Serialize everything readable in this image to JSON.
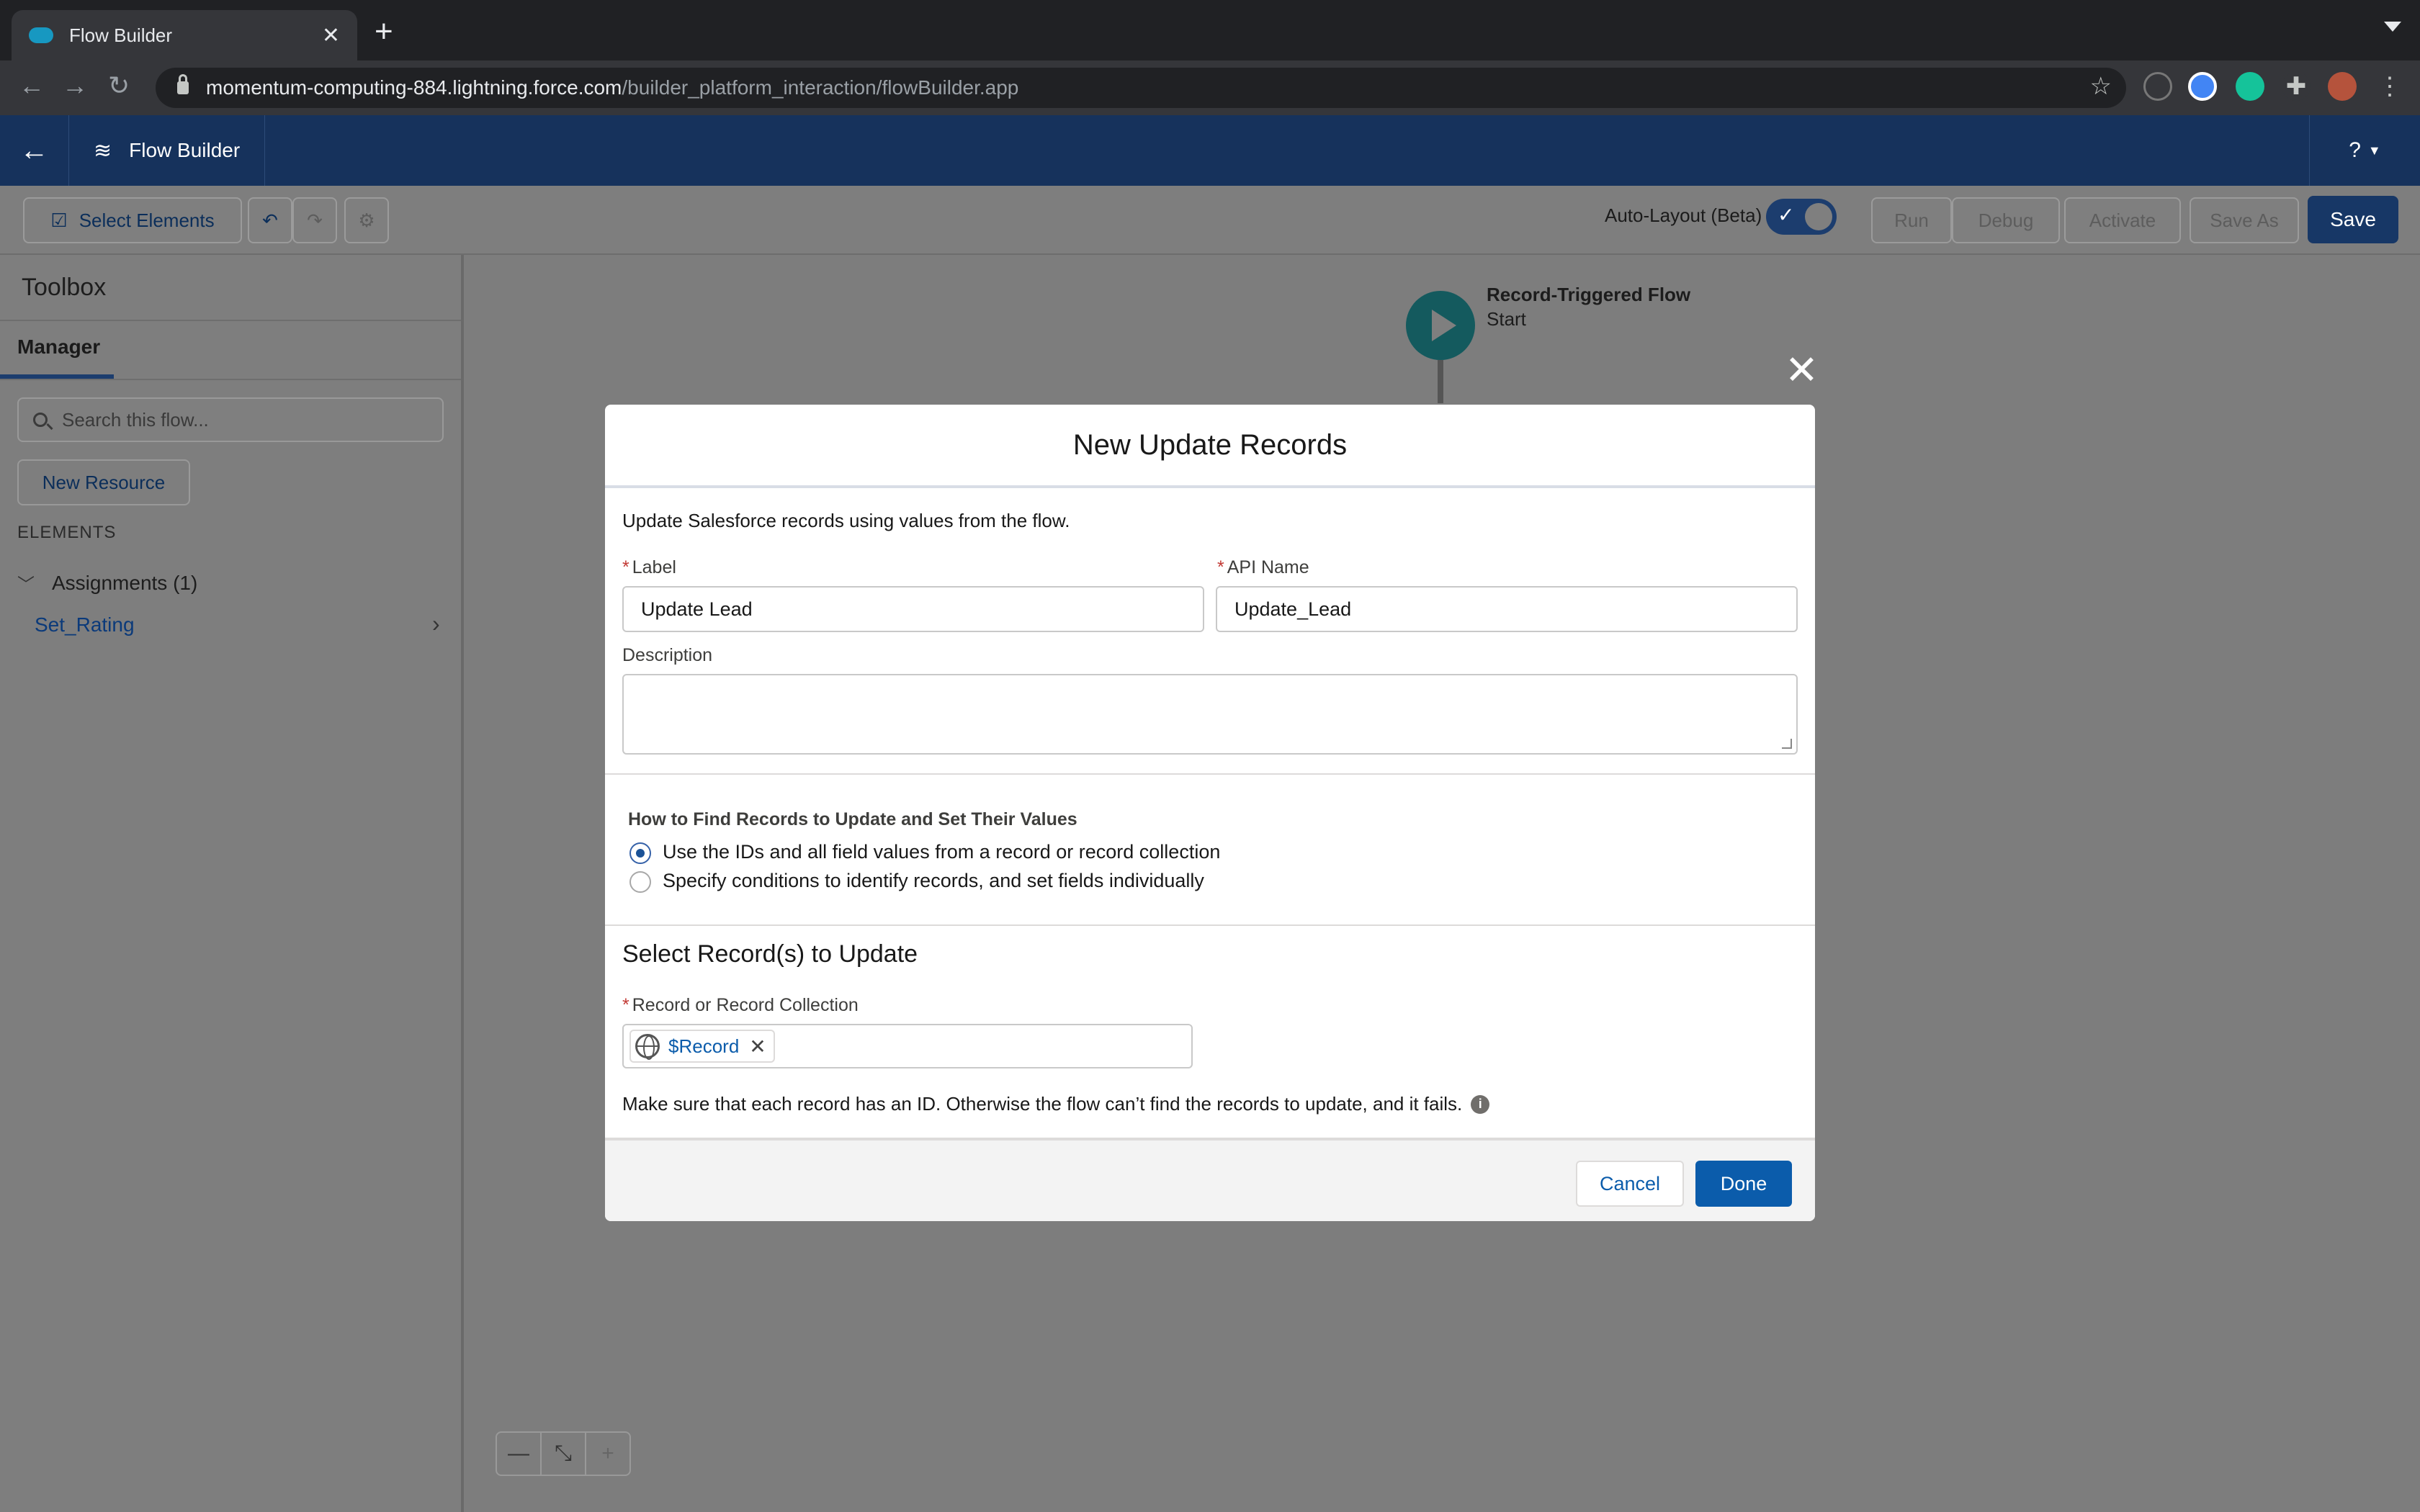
{
  "browser": {
    "tab_title": "Flow Builder",
    "url_host": "momentum-computing-884.lightning.force.com",
    "url_path": "/builder_platform_interaction/flowBuilder.app"
  },
  "app": {
    "name": "Flow Builder",
    "help": "?"
  },
  "toolbar": {
    "select_elements": "Select Elements",
    "auto_layout_label": "Auto-Layout (Beta)",
    "auto_layout_on": true,
    "run": "Run",
    "debug": "Debug",
    "activate": "Activate",
    "save_as": "Save As",
    "save": "Save"
  },
  "sidebar": {
    "title": "Toolbox",
    "tab": "Manager",
    "search_placeholder": "Search this flow...",
    "new_resource": "New Resource",
    "elements_heading": "ELEMENTS",
    "group_label": "Assignments (1)",
    "items": [
      {
        "label": "Set_Rating"
      }
    ]
  },
  "canvas": {
    "flow_type": "Record-Triggered Flow",
    "start_label": "Start"
  },
  "modal": {
    "title": "New Update Records",
    "intro": "Update Salesforce records using values from the flow.",
    "label_label": "Label",
    "label_value": "Update Lead",
    "api_label": "API Name",
    "api_value": "Update_Lead",
    "description_label": "Description",
    "how_title": "How to Find Records to Update and Set Their Values",
    "options": [
      {
        "label": "Use the IDs and all field values from a record or record collection",
        "selected": true
      },
      {
        "label": "Specify conditions to identify records, and set fields individually",
        "selected": false
      }
    ],
    "select_title": "Select Record(s) to Update",
    "record_label": "Record or Record Collection",
    "record_value": "$Record",
    "note": "Make sure that each record has an ID. Otherwise the flow can’t find the records to update, and it fails.",
    "cancel": "Cancel",
    "done": "Done"
  }
}
